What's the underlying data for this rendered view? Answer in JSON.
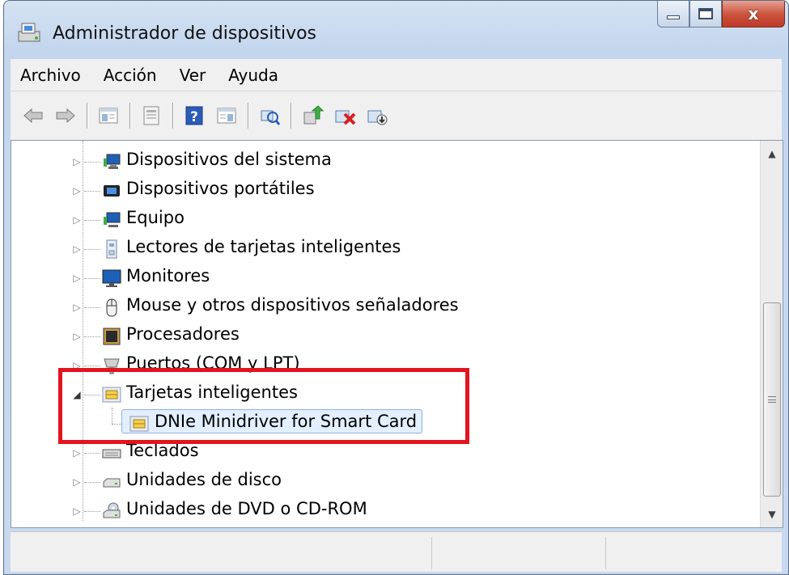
{
  "window": {
    "title": "Administrador de dispositivos",
    "caption_buttons": {
      "minimize_glyph": "minimize",
      "maximize_glyph": "maximize",
      "close_glyph": "x"
    }
  },
  "menu": {
    "items": [
      "Archivo",
      "Acción",
      "Ver",
      "Ayuda"
    ]
  },
  "toolbar": {
    "buttons": [
      "back-arrow-icon",
      "forward-arrow-icon",
      "show-hide-console-tree-icon",
      "properties-icon",
      "help-icon",
      "show-action-pane-icon",
      "scan-hardware-icon",
      "update-driver-icon",
      "uninstall-icon",
      "disable-device-icon"
    ]
  },
  "tree": {
    "items": [
      {
        "label": "Dispositivos del sistema",
        "icon": "system-devices-icon",
        "expanded": false
      },
      {
        "label": "Dispositivos portátiles",
        "icon": "portable-devices-icon",
        "expanded": false
      },
      {
        "label": "Equipo",
        "icon": "computer-icon",
        "expanded": false
      },
      {
        "label": "Lectores de tarjetas inteligentes",
        "icon": "smart-card-reader-icon",
        "expanded": false
      },
      {
        "label": "Monitores",
        "icon": "monitor-icon",
        "expanded": false
      },
      {
        "label": "Mouse y otros dispositivos señaladores",
        "icon": "mouse-icon",
        "expanded": false
      },
      {
        "label": "Procesadores",
        "icon": "processor-icon",
        "expanded": false
      },
      {
        "label": "Puertos (COM y LPT)",
        "icon": "port-icon",
        "expanded": false
      },
      {
        "label": "Tarjetas inteligentes",
        "icon": "smart-card-icon",
        "expanded": true
      },
      {
        "label": "DNIe Minidriver for Smart Card",
        "icon": "smart-card-icon",
        "child": true,
        "selected": true
      },
      {
        "label": "Teclados",
        "icon": "keyboard-icon",
        "expanded": false
      },
      {
        "label": "Unidades de disco",
        "icon": "disk-drive-icon",
        "expanded": false
      },
      {
        "label": "Unidades de DVD o CD-ROM",
        "icon": "dvd-drive-icon",
        "expanded": false
      }
    ]
  },
  "colors": {
    "highlight_box": "#e3141e",
    "selection_bg": "#e3efff",
    "selection_border": "#8fb3e0"
  }
}
